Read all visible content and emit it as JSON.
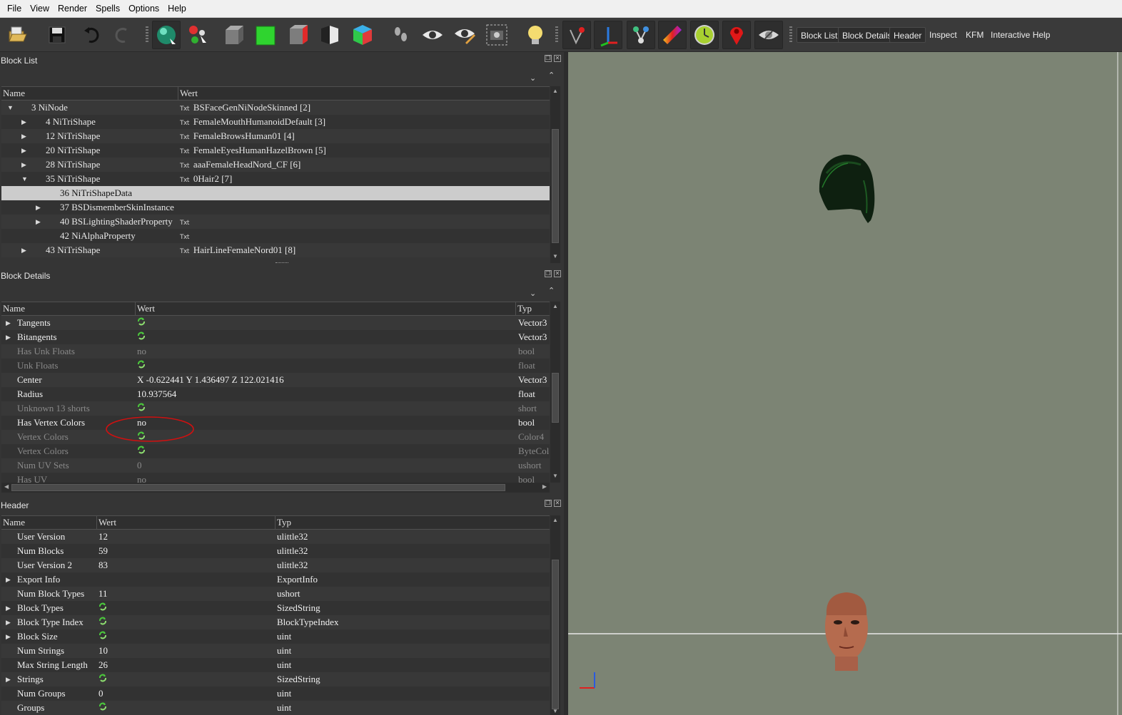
{
  "menu": [
    "File",
    "View",
    "Render",
    "Spells",
    "Options",
    "Help"
  ],
  "toolbar_tabs": [
    "Block List",
    "Block Details",
    "Header",
    "Inspect",
    "KFM",
    "Interactive Help"
  ],
  "block_list": {
    "title": "Block List",
    "columns": [
      "Name",
      "Wert"
    ],
    "rows": [
      {
        "depth": 0,
        "arrow": "down",
        "name": "3 NiNode",
        "txt": true,
        "value": "BSFaceGenNiNodeSkinned [2]"
      },
      {
        "depth": 1,
        "arrow": "right",
        "name": "4 NiTriShape",
        "txt": true,
        "value": "FemaleMouthHumanoidDefault [3]"
      },
      {
        "depth": 1,
        "arrow": "right",
        "name": "12 NiTriShape",
        "txt": true,
        "value": "FemaleBrowsHuman01 [4]"
      },
      {
        "depth": 1,
        "arrow": "right",
        "name": "20 NiTriShape",
        "txt": true,
        "value": "FemaleEyesHumanHazelBrown [5]"
      },
      {
        "depth": 1,
        "arrow": "right",
        "name": "28 NiTriShape",
        "txt": true,
        "value": "aaaFemaleHeadNord_CF [6]"
      },
      {
        "depth": 1,
        "arrow": "down",
        "name": "35 NiTriShape",
        "txt": true,
        "value": "0Hair2 [7]"
      },
      {
        "depth": 2,
        "arrow": "",
        "name": "36 NiTriShapeData",
        "txt": false,
        "value": "",
        "selected": true
      },
      {
        "depth": 2,
        "arrow": "right",
        "name": "37 BSDismemberSkinInstance",
        "txt": false,
        "value": ""
      },
      {
        "depth": 2,
        "arrow": "right",
        "name": "40 BSLightingShaderProperty",
        "txt": true,
        "value": ""
      },
      {
        "depth": 2,
        "arrow": "",
        "name": "42 NiAlphaProperty",
        "txt": true,
        "value": ""
      },
      {
        "depth": 1,
        "arrow": "right",
        "name": "43 NiTriShape",
        "txt": true,
        "value": "HairLineFemaleNord01 [8]"
      }
    ]
  },
  "block_details": {
    "title": "Block Details",
    "columns": [
      "Name",
      "Wert",
      "Typ"
    ],
    "rows": [
      {
        "arrow": "right",
        "name": "Tangents",
        "value": "",
        "ref": true,
        "type": "Vector3",
        "style": "bold"
      },
      {
        "arrow": "right",
        "name": "Bitangents",
        "value": "",
        "ref": true,
        "type": "Vector3",
        "style": "bold"
      },
      {
        "arrow": "",
        "name": "Has Unk Floats",
        "value": "no",
        "ref": false,
        "type": "bool",
        "style": "dim"
      },
      {
        "arrow": "",
        "name": "Unk Floats",
        "value": "",
        "ref": true,
        "type": "float",
        "style": "dim"
      },
      {
        "arrow": "",
        "name": "Center",
        "value": "X -0.622441 Y 1.436497 Z 122.021416",
        "ref": false,
        "type": "Vector3",
        "style": "bold"
      },
      {
        "arrow": "",
        "name": "Radius",
        "value": "10.937564",
        "ref": false,
        "type": "float",
        "style": "bold"
      },
      {
        "arrow": "",
        "name": "Unknown 13 shorts",
        "value": "",
        "ref": true,
        "type": "short",
        "style": "dim"
      },
      {
        "arrow": "",
        "name": "Has Vertex Colors",
        "value": "no",
        "ref": false,
        "type": "bool",
        "style": "bold"
      },
      {
        "arrow": "",
        "name": "Vertex Colors",
        "value": "",
        "ref": true,
        "type": "Color4",
        "style": "dim"
      },
      {
        "arrow": "",
        "name": "Vertex Colors",
        "value": "",
        "ref": true,
        "type": "ByteCol",
        "style": "dim"
      },
      {
        "arrow": "",
        "name": "Num UV Sets",
        "value": "0",
        "ref": false,
        "type": "ushort",
        "style": "dim"
      },
      {
        "arrow": "",
        "name": "Has UV",
        "value": "no",
        "ref": false,
        "type": "bool",
        "style": "dim"
      }
    ]
  },
  "header_panel": {
    "title": "Header",
    "columns": [
      "Name",
      "Wert",
      "Typ"
    ],
    "rows": [
      {
        "arrow": "",
        "name": "User Version",
        "value": "12",
        "ref": false,
        "type": "ulittle32"
      },
      {
        "arrow": "",
        "name": "Num Blocks",
        "value": "59",
        "ref": false,
        "type": "ulittle32"
      },
      {
        "arrow": "",
        "name": "User Version 2",
        "value": "83",
        "ref": false,
        "type": "ulittle32"
      },
      {
        "arrow": "right",
        "name": "Export Info",
        "value": "",
        "ref": false,
        "type": "ExportInfo"
      },
      {
        "arrow": "",
        "name": "Num Block Types",
        "value": "11",
        "ref": false,
        "type": "ushort"
      },
      {
        "arrow": "right",
        "name": "Block Types",
        "value": "",
        "ref": true,
        "type": "SizedString"
      },
      {
        "arrow": "right",
        "name": "Block Type Index",
        "value": "",
        "ref": true,
        "type": "BlockTypeIndex"
      },
      {
        "arrow": "right",
        "name": "Block Size",
        "value": "",
        "ref": true,
        "type": "uint"
      },
      {
        "arrow": "",
        "name": "Num Strings",
        "value": "10",
        "ref": false,
        "type": "uint"
      },
      {
        "arrow": "",
        "name": "Max String Length",
        "value": "26",
        "ref": false,
        "type": "uint"
      },
      {
        "arrow": "right",
        "name": "Strings",
        "value": "",
        "ref": true,
        "type": "SizedString"
      },
      {
        "arrow": "",
        "name": "Num Groups",
        "value": "0",
        "ref": false,
        "type": "uint"
      },
      {
        "arrow": "",
        "name": "Groups",
        "value": "",
        "ref": true,
        "type": "uint"
      }
    ]
  },
  "txt_icon_label": "Txt",
  "colors": {
    "viewport_bg": "#7c8474",
    "selection": "#cccccc",
    "annotation": "#d01010",
    "ref_icon": "#4bc83c"
  }
}
